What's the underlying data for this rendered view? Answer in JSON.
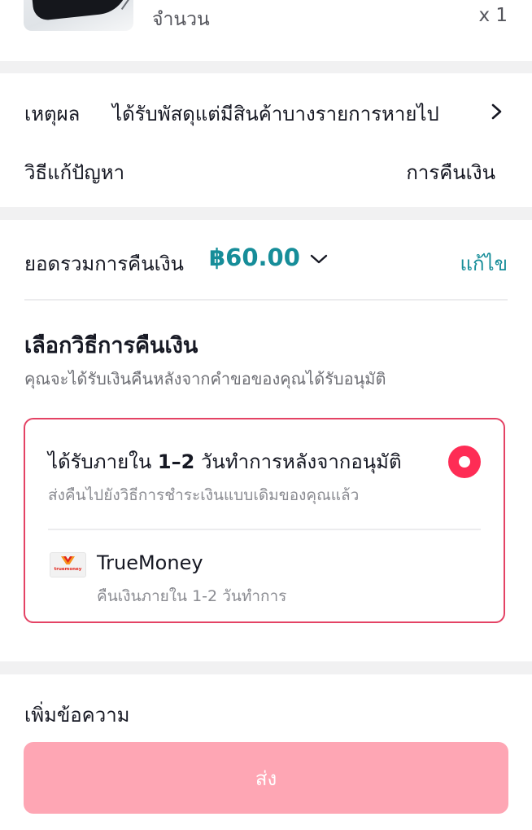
{
  "product": {
    "quantity_label": "จำนวน",
    "quantity_value": "x 1"
  },
  "reason": {
    "label": "เหตุผล",
    "value": "ได้รับพัสดุแต่มีสินค้าบางรายการหายไป",
    "solution_label": "วิธีแก้ปัญหา",
    "solution_value": "การคืนเงิน"
  },
  "refund": {
    "total_label": "ยอดรวมการคืนเงิน",
    "total_amount": "฿60.00",
    "edit_label": "แก้ไข",
    "method_title": "เลือกวิธีการคืนเงิน",
    "method_subtitle": "คุณจะได้รับเงินคืนหลังจากคำขอของคุณได้รับอนุมัติ",
    "option": {
      "title_prefix": "ได้รับภายใน ",
      "title_bold": "1–2",
      "title_suffix": " วันทำการหลังจากอนุมัติ",
      "subtitle": "ส่งคืนไปยังวิธีการชำระเงินแบบเดิมของคุณแล้ว",
      "selected": true,
      "wallet_name": "TrueMoney",
      "wallet_logo_text": "truemoney",
      "wallet_note": "คืนเงินภายใน 1-2 วันทำการ"
    }
  },
  "message": {
    "label": "เพิ่มข้อความ"
  },
  "submit": {
    "label": "ส่ง"
  },
  "colors": {
    "accent": "#168d99",
    "selected": "#fe2c55",
    "card_border": "#e44264",
    "button_disabled": "#fea6b4"
  }
}
